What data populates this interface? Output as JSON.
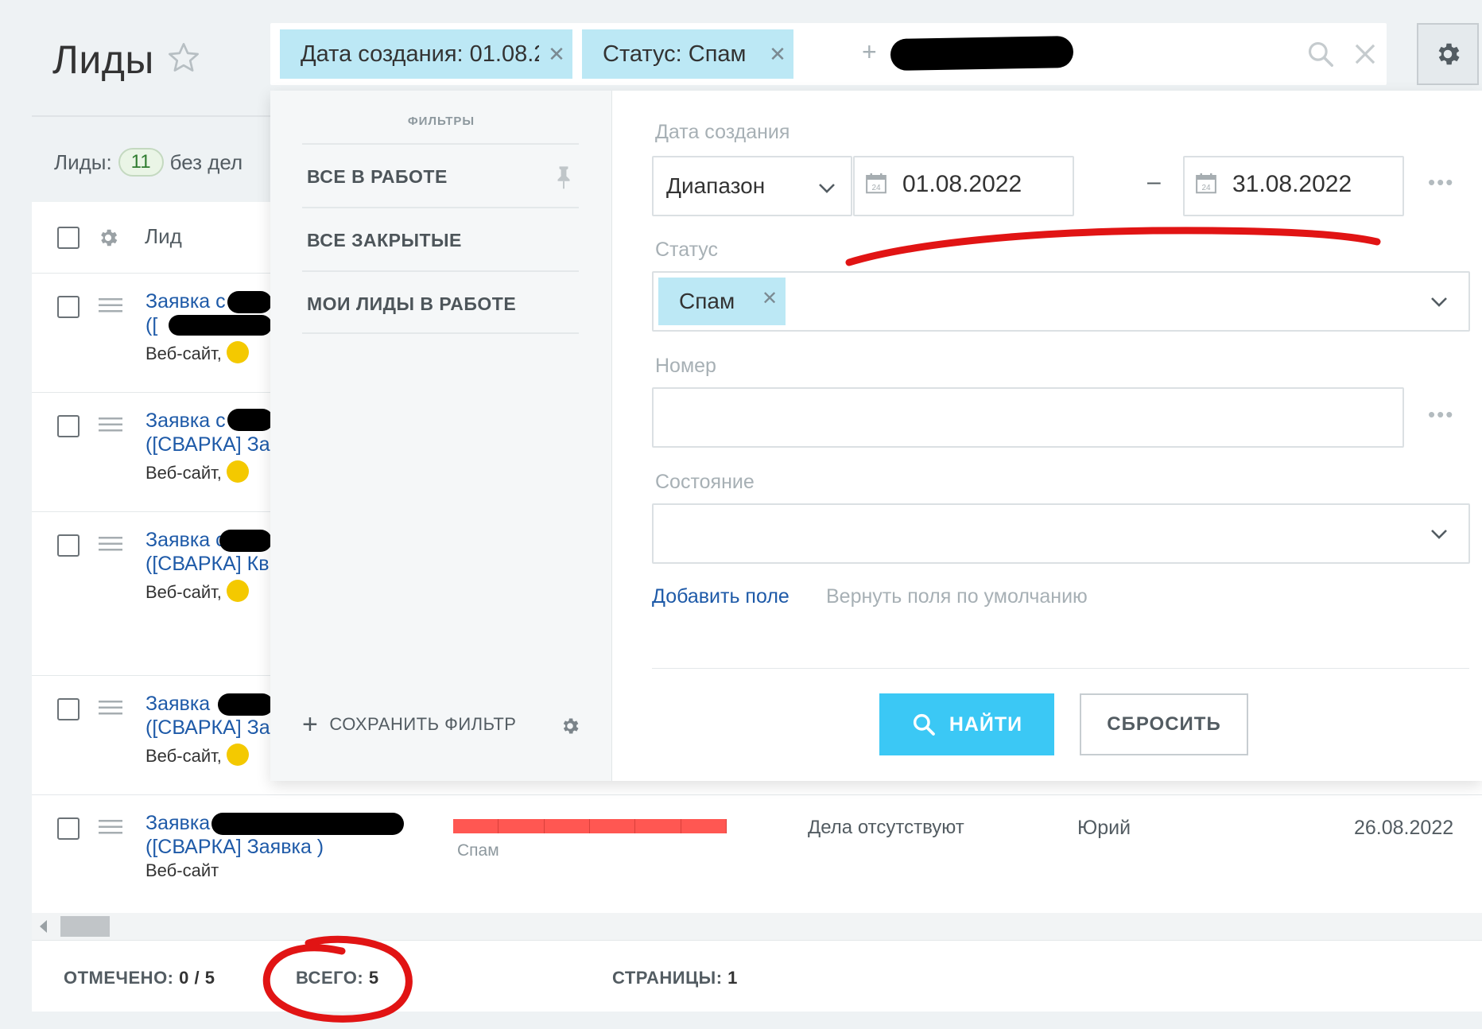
{
  "header": {
    "title": "Лиды"
  },
  "search": {
    "chips": [
      {
        "label": "Дата создания: 01.08.2…"
      },
      {
        "label": "Статус: Спам"
      }
    ],
    "plus": "+"
  },
  "counter": {
    "label": "Лиды:",
    "count": "11",
    "suffix": "без дел"
  },
  "table": {
    "header_lead": "Лид",
    "rows": [
      {
        "title_line1": "Заявка с",
        "title_line2": "([",
        "source": "Веб-сайт,",
        "has_badge": true
      },
      {
        "title_line1": "Заявка с",
        "title_line2": "([СВАРКА] За",
        "source": "Веб-сайт,",
        "has_badge": true
      },
      {
        "title_line1": "Заявка с",
        "title_line2": "([СВАРКА] Кв",
        "source": "Веб-сайт,",
        "has_badge": true
      },
      {
        "title_line1": "Заявка",
        "title_line2": "([СВАРКА] За",
        "source": "Веб-сайт,",
        "has_badge": true
      },
      {
        "title_line1": "Заявка с",
        "title_line2": "([СВАРКА] Заявка )",
        "source": "Веб-сайт",
        "has_badge": false,
        "stage": "Спам",
        "activity": "Дела отсутствуют",
        "responsible": "Юрий",
        "date": "26.08.2022"
      }
    ]
  },
  "footer": {
    "selected_label": "ОТМЕЧЕНО:",
    "selected_value": "0 / 5",
    "total_label": "ВСЕГО:",
    "total_value": "5",
    "pages_label": "СТРАНИЦЫ:",
    "pages_value": "1"
  },
  "filter_popup": {
    "presets_title": "ФИЛЬТРЫ",
    "presets": [
      "ВСЕ В РАБОТЕ",
      "ВСЕ ЗАКРЫТЫЕ",
      "МОИ ЛИДЫ В РАБОТЕ"
    ],
    "save_filter": "СОХРАНИТЬ ФИЛЬТР",
    "fields": {
      "date_label": "Дата создания",
      "date_mode": "Диапазон",
      "date_from": "01.08.2022",
      "date_dash": "–",
      "date_to": "31.08.2022",
      "status_label": "Статус",
      "status_value": "Спам",
      "number_label": "Номер",
      "number_value": "",
      "state_label": "Состояние",
      "state_value": ""
    },
    "add_field": "Добавить поле",
    "restore_fields": "Вернуть поля по умолчанию",
    "find": "НАЙТИ",
    "reset": "СБРОСИТЬ"
  },
  "icons": {
    "star": "star-icon",
    "search": "search-icon",
    "close": "close-icon",
    "settings": "gear-icon",
    "calendar": "calendar-icon",
    "pin": "pin-icon"
  },
  "colors": {
    "accent": "#3bc8f5",
    "chip": "#bce8f5",
    "link": "#1e5aa8",
    "stage_spam": "#ff5752",
    "annotation": "#e11414"
  }
}
